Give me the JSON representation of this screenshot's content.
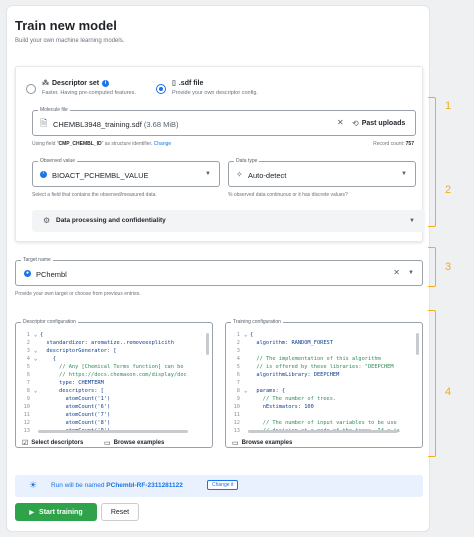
{
  "header": {
    "title": "Train new model",
    "subtitle": "Build your own machine learning models."
  },
  "descriptor_source": {
    "options": [
      {
        "label": "Descriptor set",
        "description": "Faster. Having pre-computed features.",
        "selected": false
      },
      {
        "label": ".sdf file",
        "description": "Provide your own descriptor config.",
        "selected": true
      }
    ]
  },
  "molecule_file": {
    "legend": "Molecule file",
    "value": "CHEMBL3948_training.sdf",
    "size": "(3.68 MiB)",
    "past_uploads_label": "Past uploads",
    "hint_prefix": "Using field \"",
    "hint_field": "CMP_CHEMBL_ID",
    "hint_suffix": "\" as structure identifier.",
    "hint_change": "Change",
    "record_count_label": "Record count:",
    "record_count": "757"
  },
  "observed_value": {
    "legend": "Observed value",
    "value": "BIOACT_PCHEMBL_VALUE",
    "hint": "Select a field that contains the observed/measured data."
  },
  "data_type": {
    "legend": "Data type",
    "value": "Auto-detect",
    "hint": "% observed data continuous or it has discrete values?"
  },
  "accordion": {
    "label": "Data processing and confidentiality"
  },
  "target_name": {
    "legend": "Target name",
    "value": "PChembl",
    "hint": "Provide your own target or choose from previous entries."
  },
  "descriptor_config": {
    "legend": "Descriptor configuration",
    "lines": [
      {
        "n": "1",
        "fold": "⌄",
        "text": "{"
      },
      {
        "n": "2",
        "fold": "",
        "text": "  standardizer: aromatize..removeexplicith"
      },
      {
        "n": "3",
        "fold": "⌄",
        "text": "  descriptorGenerator: ["
      },
      {
        "n": "4",
        "fold": "⌄",
        "text": "    {"
      },
      {
        "n": "5",
        "fold": "",
        "text": "      // Any [Chemical Terms function] can be"
      },
      {
        "n": "6",
        "fold": "",
        "text": "      // https://docs.chemaxon.com/display/doc"
      },
      {
        "n": "7",
        "fold": "",
        "text": "      type: CHEMTERM"
      },
      {
        "n": "8",
        "fold": "⌄",
        "text": "      descriptors: ["
      },
      {
        "n": "9",
        "fold": "",
        "text": "        atomCount('1')"
      },
      {
        "n": "10",
        "fold": "",
        "text": "        atomCount('6')"
      },
      {
        "n": "11",
        "fold": "",
        "text": "        atomCount('7')"
      },
      {
        "n": "12",
        "fold": "",
        "text": "        atomCount('8')"
      },
      {
        "n": "13",
        "fold": "",
        "text": "        atomCount('9')"
      }
    ],
    "select_label": "Select descriptors",
    "browse_label": "Browse examples"
  },
  "training_config": {
    "legend": "Training configuration",
    "lines": [
      {
        "n": "1",
        "fold": "⌄",
        "text": "{"
      },
      {
        "n": "2",
        "fold": "",
        "text": "  algorithm: RANDOM_FOREST"
      },
      {
        "n": "3",
        "fold": "",
        "text": ""
      },
      {
        "n": "4",
        "fold": "",
        "text": "  // The implementation of this algorithm"
      },
      {
        "n": "5",
        "fold": "",
        "text": "  // is offered by these libraries: \"DEEPCHEM"
      },
      {
        "n": "6",
        "fold": "",
        "text": "  algorithmLibrary: DEEPCHEM"
      },
      {
        "n": "7",
        "fold": "",
        "text": ""
      },
      {
        "n": "8",
        "fold": "⌄",
        "text": "  params: {"
      },
      {
        "n": "9",
        "fold": "",
        "text": "    // The number of trees."
      },
      {
        "n": "10",
        "fold": "",
        "text": "    nEstimators: 100"
      },
      {
        "n": "11",
        "fold": "",
        "text": ""
      },
      {
        "n": "12",
        "fold": "",
        "text": "    // The number of input variables to be use"
      },
      {
        "n": "13",
        "fold": "",
        "text": "    // decision at a node of the trees. If a is"
      }
    ],
    "browse_label": "Browse examples"
  },
  "run_banner": {
    "prefix": "Run will be named",
    "name": "PChembl-RF-2311281122",
    "change_label": "Change it"
  },
  "actions": {
    "start_label": "Start training",
    "reset_label": "Reset"
  },
  "annotations": [
    "1",
    "2",
    "3",
    "4"
  ],
  "colors": {
    "accent": "#1a73e8",
    "primary_button": "#2fa34a",
    "annotation": "#f0ad1e"
  }
}
